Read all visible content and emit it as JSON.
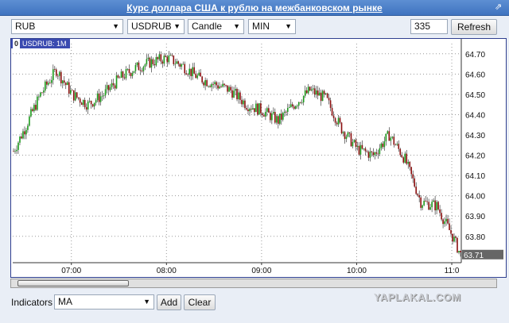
{
  "window": {
    "title": "Курс доллара США к рублю на межбанковском рынке",
    "popout_icon": "external-link-icon"
  },
  "toolbar": {
    "currency": "RUB",
    "instrument": "USDRUB",
    "chart_type": "Candle",
    "interval": "MIN",
    "bars_count": "335",
    "refresh_label": "Refresh"
  },
  "chart": {
    "tab_index": "0",
    "tab_label": "USDRUB: 1M",
    "current_price": "63.71",
    "y_ticks": [
      "64.70",
      "64.60",
      "64.50",
      "64.40",
      "64.30",
      "64.20",
      "64.10",
      "64.00",
      "63.90",
      "63.80"
    ],
    "x_ticks": [
      "07:00",
      "08:00",
      "09:00",
      "10:00",
      "11:0"
    ],
    "colors": {
      "up": "#1a9a1a",
      "down": "#8b0e0e",
      "frame": "#2f3f8f",
      "grid": "#9a9a9a"
    }
  },
  "chart_data": {
    "type": "candlestick",
    "symbol": "USDRUB: 1M",
    "ylim": [
      63.67,
      64.75
    ],
    "time_points": [
      "06:23",
      "06:30",
      "06:40",
      "06:50",
      "07:00",
      "07:10",
      "07:20",
      "07:30",
      "07:40",
      "07:50",
      "08:00",
      "08:10",
      "08:20",
      "08:30",
      "08:40",
      "08:50",
      "09:00",
      "09:10",
      "09:20",
      "09:30",
      "09:40",
      "09:50",
      "10:00",
      "10:10",
      "10:20",
      "10:30",
      "10:40",
      "10:50",
      "11:00",
      "11:05"
    ],
    "close_values": [
      64.22,
      64.33,
      64.5,
      64.62,
      64.5,
      64.45,
      64.5,
      64.58,
      64.63,
      64.66,
      64.68,
      64.64,
      64.58,
      64.55,
      64.52,
      64.45,
      64.42,
      64.37,
      64.45,
      64.52,
      64.48,
      64.33,
      64.23,
      64.2,
      64.3,
      64.18,
      63.97,
      63.95,
      63.8,
      63.71
    ]
  },
  "bottom": {
    "indicators_label": "Indicators",
    "indicator_value": "MA",
    "add_label": "Add",
    "clear_label": "Clear"
  },
  "watermark": "YAPLAKAL.COM"
}
